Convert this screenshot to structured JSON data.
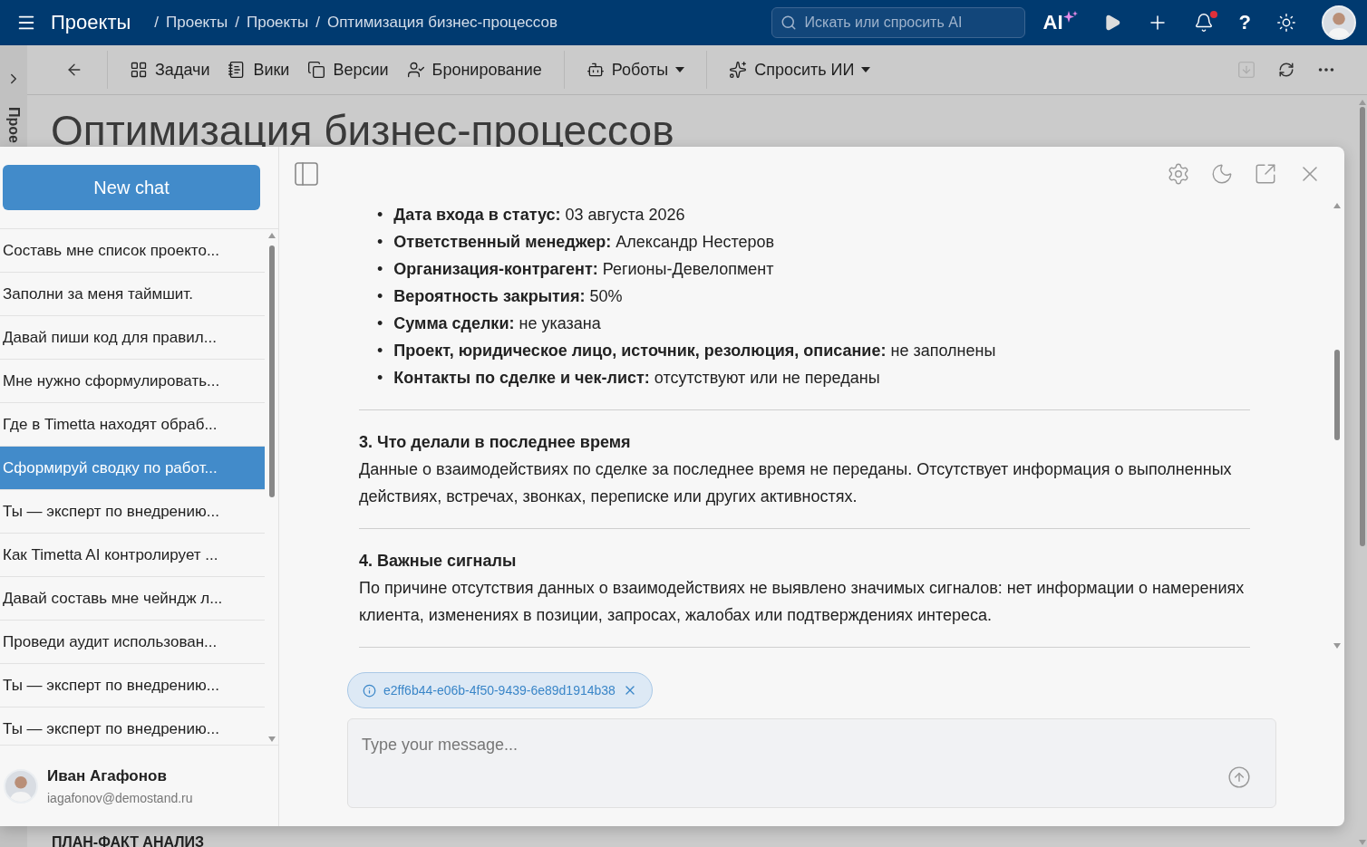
{
  "nav": {
    "app_title": "Проекты",
    "breadcrumbs": [
      {
        "separator": "/",
        "label": "Проекты"
      },
      {
        "separator": "/",
        "label": "Проекты"
      },
      {
        "separator": "/",
        "label": "Оптимизация бизнес-процессов"
      }
    ],
    "search_placeholder": "Искать или спросить AI",
    "ai_label": "AI",
    "help_glyph": "?",
    "has_notification": true
  },
  "side_strip": {
    "label": "Прое"
  },
  "toolbar": {
    "groups": [
      [
        {
          "label": "Задачи",
          "dropdown": false
        },
        {
          "label": "Вики",
          "dropdown": false
        },
        {
          "label": "Версии",
          "dropdown": false
        },
        {
          "label": "Бронирование",
          "dropdown": false
        }
      ],
      [
        {
          "label": "Роботы",
          "dropdown": true
        }
      ],
      [
        {
          "label": "Спросить ИИ",
          "dropdown": true
        }
      ]
    ]
  },
  "page": {
    "title": "Оптимизация бизнес-процессов",
    "section": "ПЛАН-ФАКТ АНАЛИЗ"
  },
  "chat": {
    "new_chat": "New chat",
    "history": [
      {
        "title": "Составь мне список проекто...",
        "selected": false
      },
      {
        "title": "Заполни за меня таймшит.",
        "selected": false
      },
      {
        "title": "Давай пиши код для правил...",
        "selected": false
      },
      {
        "title": "Мне нужно сформулировать...",
        "selected": false
      },
      {
        "title": "Где в Timetta находят обраб...",
        "selected": false
      },
      {
        "title": "Сформируй сводку по работ...",
        "selected": true
      },
      {
        "title": "Ты — эксперт по внедрению...",
        "selected": false
      },
      {
        "title": "Как Timetta AI контролирует ...",
        "selected": false
      },
      {
        "title": "Давай составь мне чейндж л...",
        "selected": false
      },
      {
        "title": "Проведи аудит использован...",
        "selected": false
      },
      {
        "title": "Ты — эксперт по внедрению...",
        "selected": false
      },
      {
        "title": "Ты — эксперт по внедрению...",
        "selected": false
      }
    ],
    "user": {
      "name": "Иван Агафонов",
      "email": "iagafonov@demostand.ru"
    },
    "answer": {
      "bullets": [
        {
          "marker": "•",
          "text": "**Дата входа в статус:** 03 августа 2026"
        },
        {
          "marker": "•",
          "text": "**Ответственный менеджер:** Александр Нестеров"
        },
        {
          "marker": "•",
          "text": "**Организация-контрагент:** Регионы-Девелопмент"
        },
        {
          "marker": "•",
          "text": "**Вероятность закрытия:** 50%"
        },
        {
          "marker": "•",
          "text": "**Сумма сделки:** не указана"
        },
        {
          "marker": "•",
          "text": "**Проект, юридическое лицо, источник, резолюция, описание:** не заполнены"
        },
        {
          "marker": "•",
          "text": "**Контакты по сделке и чек-лист:** отсутствуют или не переданы"
        }
      ],
      "sections": [
        {
          "heading": "3. Что делали в последнее время",
          "text": "Данные о взаимодействиях по сделке за последнее время не переданы. Отсутствует информация о выполненных действиях, встречах, звонках, переписке или других активностях."
        },
        {
          "heading": "4. Важные сигналы",
          "text": "По причине отсутствия данных о взаимодействиях не выявлено значимых сигналов: нет информации о намерениях клиента, изменениях в позиции, запросах, жалобах или подтверждениях интереса."
        }
      ]
    },
    "attachment": "e2ff6b44-e06b-4f50-9439-6e89d1914b38",
    "input_placeholder": "Type your message..."
  }
}
